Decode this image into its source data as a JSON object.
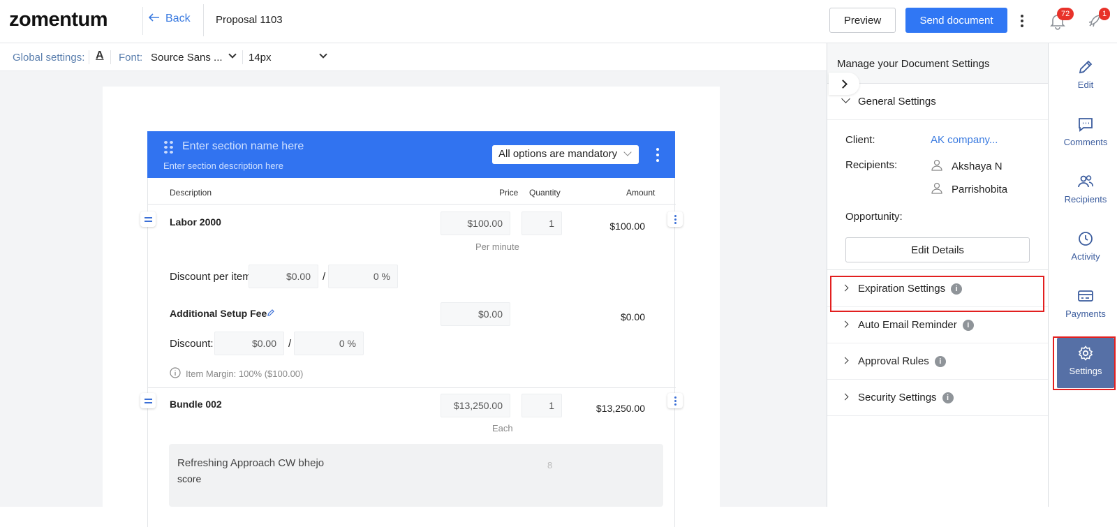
{
  "header": {
    "logo": "zomentum",
    "back_label": "Back",
    "doc_title": "Proposal 1103",
    "preview_label": "Preview",
    "send_label": "Send document",
    "notifications_count": "72",
    "rocket_count": "1"
  },
  "toolbar": {
    "global_settings_label": "Global settings:",
    "text_color_icon": "A",
    "font_label": "Font:",
    "font_value": "Source Sans ...",
    "size_value": "14px"
  },
  "section": {
    "name_placeholder": "Enter section name here",
    "desc_placeholder": "Enter section description here",
    "mandatory_select": "All options are mandatory"
  },
  "table": {
    "headers": {
      "description": "Description",
      "price": "Price",
      "quantity": "Quantity",
      "amount": "Amount"
    },
    "item1": {
      "name": "Labor 2000",
      "price": "$100.00",
      "unit": "Per minute",
      "quantity": "1",
      "amount": "$100.00",
      "discount_label": "Discount per item:",
      "discount_amount": "$0.00",
      "discount_sep": "/",
      "discount_percent": "0 %"
    },
    "fee": {
      "name": "Additional Setup Fee",
      "price": "$0.00",
      "amount": "$0.00",
      "discount_label": "Discount:",
      "discount_amount": "$0.00",
      "discount_sep": "/",
      "discount_percent": "0 %",
      "margin_note": "Item Margin: 100% ($100.00)"
    },
    "item2": {
      "name": "Bundle 002",
      "price": "$13,250.00",
      "unit": "Each",
      "quantity": "1",
      "amount": "$13,250.00",
      "bundle_title": "Refreshing Approach CW bhejo",
      "bundle_sub": "score",
      "bundle_qty": "8"
    }
  },
  "panel": {
    "title": "Manage your Document Settings",
    "general": "General Settings",
    "client_label": "Client:",
    "client_value": "AK company...",
    "recipients_label": "Recipients:",
    "recipients": [
      "Akshaya N",
      "Parrishobita"
    ],
    "opportunity_label": "Opportunity:",
    "edit_details": "Edit Details",
    "sections": [
      "Expiration Settings",
      "Auto Email Reminder",
      "Approval Rules",
      "Security Settings"
    ]
  },
  "rail": {
    "items": [
      "Edit",
      "Comments",
      "Recipients",
      "Activity",
      "Payments",
      "Settings"
    ],
    "active": "Settings"
  },
  "colors": {
    "primary": "#3077f4",
    "rail": "#3c5d9e",
    "rail_active": "#5670a6",
    "highlight": "#e21f1f"
  }
}
